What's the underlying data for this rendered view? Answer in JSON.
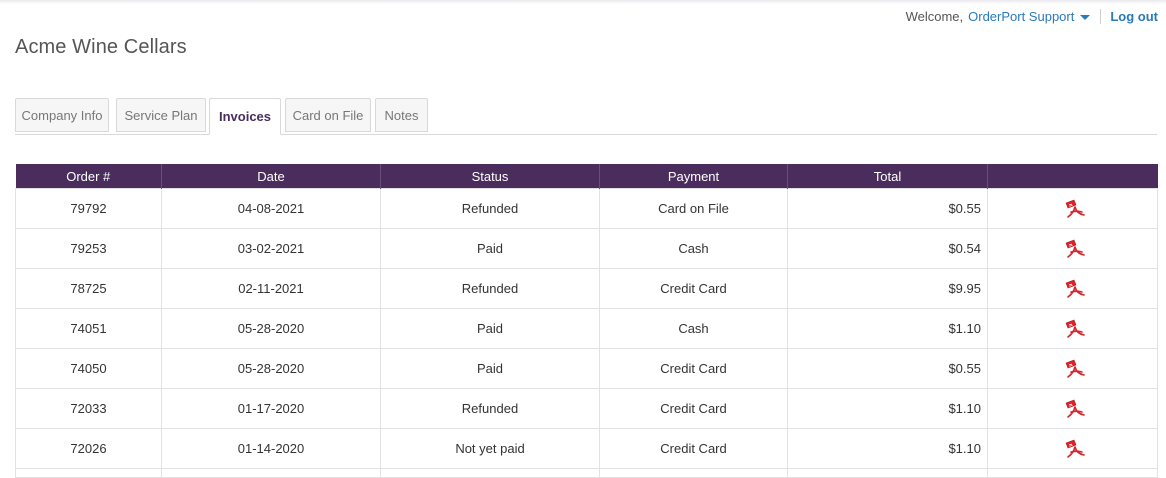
{
  "header": {
    "welcome": "Welcome,",
    "user_name": "OrderPort Support",
    "logout": "Log out"
  },
  "company_name": "Acme Wine Cellars",
  "tabs": [
    {
      "label": "Company Info",
      "active": false
    },
    {
      "label": "Service Plan",
      "active": false
    },
    {
      "label": "Invoices",
      "active": true
    },
    {
      "label": "Card on File",
      "active": false
    },
    {
      "label": "Notes",
      "active": false
    }
  ],
  "invoices": {
    "columns": [
      "Order #",
      "Date",
      "Status",
      "Payment",
      "Total",
      ""
    ],
    "rows": [
      {
        "order": "79792",
        "date": "04-08-2021",
        "status": "Refunded",
        "payment": "Card on File",
        "total": "$0.55",
        "icon": "pdf-icon"
      },
      {
        "order": "79253",
        "date": "03-02-2021",
        "status": "Paid",
        "payment": "Cash",
        "total": "$0.54",
        "icon": "pdf-icon"
      },
      {
        "order": "78725",
        "date": "02-11-2021",
        "status": "Refunded",
        "payment": "Credit Card",
        "total": "$9.95",
        "icon": "pdf-icon"
      },
      {
        "order": "74051",
        "date": "05-28-2020",
        "status": "Paid",
        "payment": "Cash",
        "total": "$1.10",
        "icon": "pdf-icon"
      },
      {
        "order": "74050",
        "date": "05-28-2020",
        "status": "Paid",
        "payment": "Credit Card",
        "total": "$0.55",
        "icon": "pdf-icon"
      },
      {
        "order": "72033",
        "date": "01-17-2020",
        "status": "Refunded",
        "payment": "Credit Card",
        "total": "$1.10",
        "icon": "pdf-icon"
      },
      {
        "order": "72026",
        "date": "01-14-2020",
        "status": "Not yet paid",
        "payment": "Credit Card",
        "total": "$1.10",
        "icon": "pdf-icon"
      }
    ]
  },
  "colors": {
    "header_bg": "#4a2d5c",
    "link": "#2a7ab8",
    "pdf_red": "#d9232b"
  }
}
